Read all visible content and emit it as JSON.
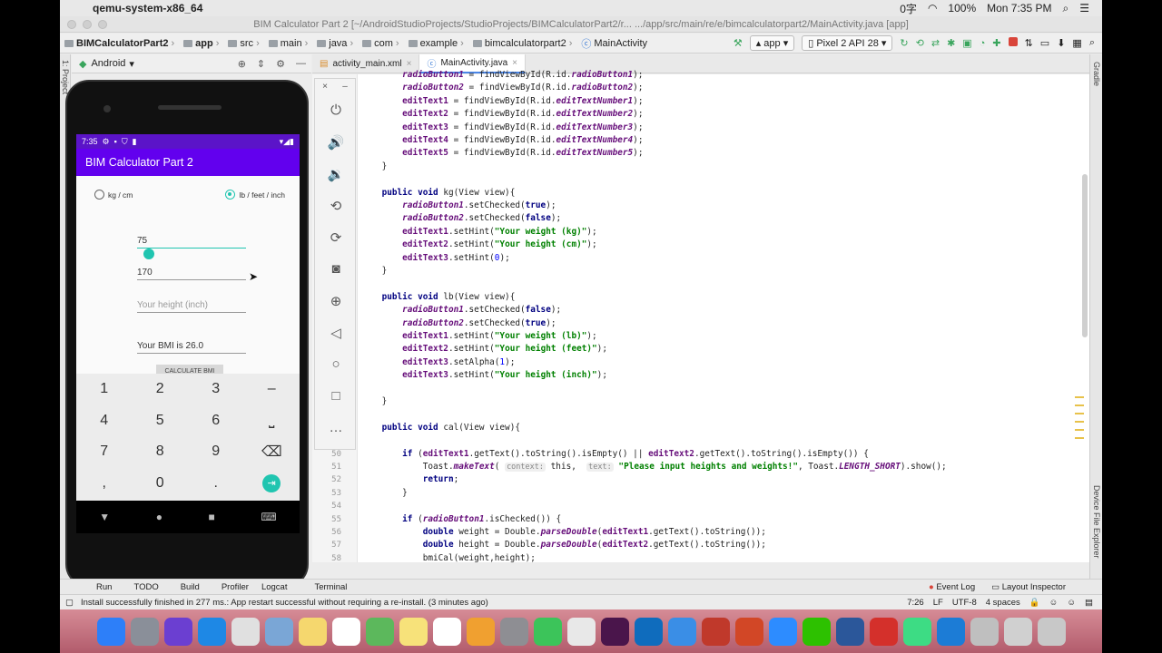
{
  "mac_menu": {
    "app_name": "qemu-system-x86_64",
    "status_right": [
      "0字",
      "100%",
      "Mon 7:35 PM"
    ]
  },
  "window_title": "BIM Calculator Part 2 [~/AndroidStudioProjects/StudioProjects/BIMCalculatorPart2/r... .../app/src/main/re/e/bimcalculatorpart2/MainActivity.java [app]",
  "breadcrumbs": [
    "BIMCalculatorPart2",
    "app",
    "src",
    "main",
    "java",
    "com",
    "example",
    "bimcalculatorpart2",
    "MainActivity"
  ],
  "toolbar": {
    "module": "app",
    "device": "Pixel 2 API 28"
  },
  "project_panel": {
    "label": "Android"
  },
  "editor_tabs": [
    "activity_main.xml",
    "MainActivity.java"
  ],
  "side_labels": {
    "left": "1: Project",
    "right_top": "Gradle",
    "right_bottom": "Device File Explorer"
  },
  "code_lines": [
    {
      "n": "",
      "c": "        radioButton1 = findViewById(R.id.radioButton1);"
    },
    {
      "n": "",
      "c": "        radioButton2 = findViewById(R.id.radioButton2);"
    },
    {
      "n": "",
      "c": "        editText1 = findViewById(R.id.editTextNumber1);"
    },
    {
      "n": "",
      "c": "        editText2 = findViewById(R.id.editTextNumber2);"
    },
    {
      "n": "",
      "c": "        editText3 = findViewById(R.id.editTextNumber3);"
    },
    {
      "n": "",
      "c": "        editText4 = findViewById(R.id.editTextNumber4);"
    },
    {
      "n": "",
      "c": "        editText5 = findViewById(R.id.editTextNumber5);"
    },
    {
      "n": "",
      "c": "    }"
    },
    {
      "n": "",
      "c": ""
    },
    {
      "n": "",
      "c": "    public void kg(View view){"
    },
    {
      "n": "",
      "c": "        radioButton1.setChecked(true);"
    },
    {
      "n": "",
      "c": "        radioButton2.setChecked(false);"
    },
    {
      "n": "",
      "c": "        editText1.setHint(\"Your weight (kg)\");"
    },
    {
      "n": "",
      "c": "        editText2.setHint(\"Your height (cm)\");"
    },
    {
      "n": "",
      "c": "        editText3.setHint(0);"
    },
    {
      "n": "",
      "c": "    }"
    },
    {
      "n": "",
      "c": ""
    },
    {
      "n": "",
      "c": "    public void lb(View view){"
    },
    {
      "n": "",
      "c": "        radioButton1.setChecked(false);"
    },
    {
      "n": "",
      "c": "        radioButton2.setChecked(true);"
    },
    {
      "n": "",
      "c": "        editText1.setHint(\"Your weight (lb)\");"
    },
    {
      "n": "",
      "c": "        editText2.setHint(\"Your height (feet)\");"
    },
    {
      "n": "",
      "c": "        editText3.setAlpha(1);"
    },
    {
      "n": "",
      "c": "        editText3.setHint(\"Your height (inch)\");"
    },
    {
      "n": "",
      "c": ""
    },
    {
      "n": "",
      "c": "    }"
    },
    {
      "n": "",
      "c": ""
    },
    {
      "n": "",
      "c": "    public void cal(View view){"
    },
    {
      "n": "",
      "c": ""
    },
    {
      "n": "50",
      "c": "        if (editText1.getText().toString().isEmpty() || editText2.getText().toString().isEmpty()) {"
    },
    {
      "n": "51",
      "c": "            Toast.makeText( context: this,  text: \"Please input heights and weights!\", Toast.LENGTH_SHORT).show();"
    },
    {
      "n": "52",
      "c": "            return;"
    },
    {
      "n": "53",
      "c": "        }"
    },
    {
      "n": "54",
      "c": ""
    },
    {
      "n": "55",
      "c": "        if (radioButton1.isChecked()) {"
    },
    {
      "n": "56",
      "c": "            double weight = Double.parseDouble(editText1.getText().toString());"
    },
    {
      "n": "57",
      "c": "            double height = Double.parseDouble(editText2.getText().toString());"
    },
    {
      "n": "58",
      "c": "            bmiCal(weight,height);"
    }
  ],
  "phone": {
    "time": "7:35",
    "app_title": "BIM Calculator Part 2",
    "radio_kg": "kg / cm",
    "radio_lb": "lb / feet / inch",
    "weight_value": "75",
    "height_value": "170",
    "inch_placeholder": "Your height (inch)",
    "result": "Your BMI is 26.0",
    "calc_button": "CALCULATE BMI",
    "keys": [
      [
        "1",
        "2",
        "3",
        "–"
      ],
      [
        "4",
        "5",
        "6",
        "⎵"
      ],
      [
        "7",
        "8",
        "9",
        "⌫"
      ],
      [
        ",",
        "0",
        ".",
        "⇥"
      ]
    ]
  },
  "bottom_tabs": {
    "left": [
      "Run",
      "TODO",
      "Build",
      "Profiler",
      "Logcat",
      "Terminal"
    ],
    "right": [
      "Event Log",
      "Layout Inspector"
    ]
  },
  "status": {
    "message": "Install successfully finished in 277 ms.: App restart successful without requiring a re-install. (3 minutes ago)",
    "position": "7:26",
    "line_sep": "LF",
    "encoding": "UTF-8",
    "indent": "4 spaces"
  },
  "dock_apps": [
    "Finder",
    "Launchpad",
    "Siri",
    "Safari",
    "Chrome",
    "Preview",
    "Notes",
    "Calendar",
    "Maps",
    "Stickies",
    "Reminders",
    "Photos",
    "System Preferences",
    "FaceTime",
    "TextEdit",
    "Slack",
    "Outlook",
    "Keynote",
    "Dictionary",
    "PowerPoint",
    "Zoom",
    "WeChat",
    "Word",
    "Acrobat",
    "Android Studio",
    "Xcode",
    "Documents",
    "Downloads",
    "Trash"
  ],
  "colors": {
    "accent": "#6200ee",
    "teal": "#20c5b0",
    "dock": "#c57280"
  }
}
